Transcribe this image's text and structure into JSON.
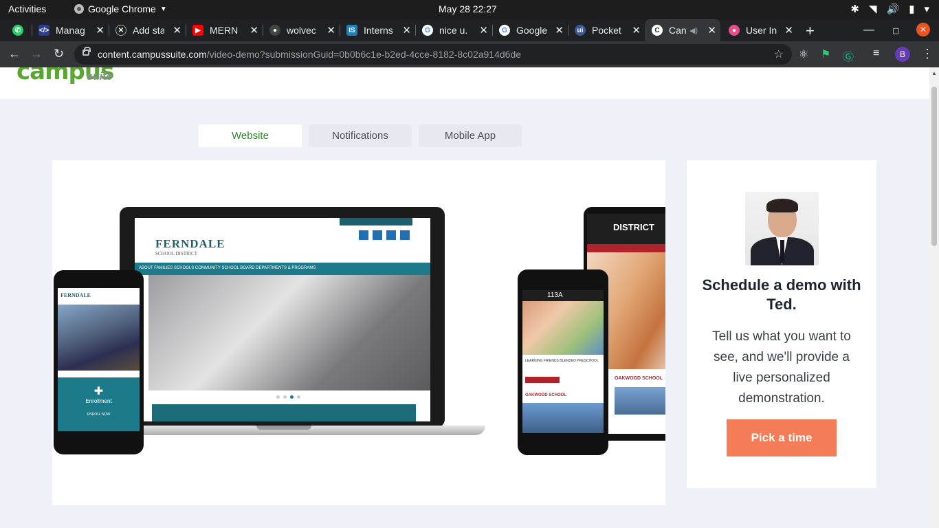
{
  "os": {
    "activities": "Activities",
    "app_name": "Google Chrome",
    "clock": "May 28  22:27"
  },
  "tabs": [
    {
      "title": "WhatsApp",
      "favicon": "whatsapp-icon",
      "color": "#25d366"
    },
    {
      "title": "Manag",
      "favicon": "code-icon",
      "color": "#3b4a8c"
    },
    {
      "title": "Add sta",
      "favicon": "x-circle-icon",
      "color": "#333"
    },
    {
      "title": "MERN S",
      "favicon": "youtube-icon",
      "color": "#ff0000"
    },
    {
      "title": "wolvec",
      "favicon": "github-icon",
      "color": "#444"
    },
    {
      "title": "Interns",
      "favicon": "internshala-icon",
      "color": "#1f80c0"
    },
    {
      "title": "nice u.",
      "favicon": "google-icon",
      "color": "#fff"
    },
    {
      "title": "Google",
      "favicon": "google-icon",
      "color": "#fff"
    },
    {
      "title": "Pocket",
      "favicon": "pocket-icon",
      "color": "#3b5998"
    },
    {
      "title": "Can",
      "favicon": "campussuite-icon",
      "color": "#555",
      "active": true
    },
    {
      "title": "User In",
      "favicon": "dribbble-icon",
      "color": "#ea4c89"
    }
  ],
  "address": {
    "host": "content.campussuite.com",
    "path": "/video-demo?submissionGuid=0b0b6c1e-b2ed-4cce-8182-8c02a914d6de"
  },
  "profile_initial": "B",
  "site": {
    "logo": "campus",
    "logo_sub": "suite",
    "tabs": [
      "Website",
      "Notifications",
      "Mobile App"
    ],
    "active_tab": "Website",
    "mockup": {
      "laptop_school": "FERNDALE",
      "laptop_school_sub": "SCHOOL DISTRICT",
      "laptop_nav": "ABOUT    FAMILIES    SCHOOLS    COMMUNITY    SCHOOL BOARD    DEPARTMENTS & PROGRAMS",
      "phone1_logo": "FERNDALE",
      "phone1_cta": "Enrollment",
      "phone1_enroll": "ENROLL NOW",
      "phone2_header": "113A",
      "phone2_text": "LEARNING FRIENDS BLENDED PRESCHOOL",
      "phone2_school": "OAKWOOD SCHOOL",
      "tablet_header": "DISTRICT",
      "tablet_school": "OAKWOOD SCHOOL"
    },
    "card": {
      "heading": "Schedule a demo with Ted.",
      "body": "Tell us what you want to see, and we'll provide a live personalized demonstration.",
      "cta": "Pick a time"
    }
  },
  "colors": {
    "brand_green": "#5aa632",
    "cta_orange": "#f47d57",
    "page_bg": "#eef1f7"
  }
}
